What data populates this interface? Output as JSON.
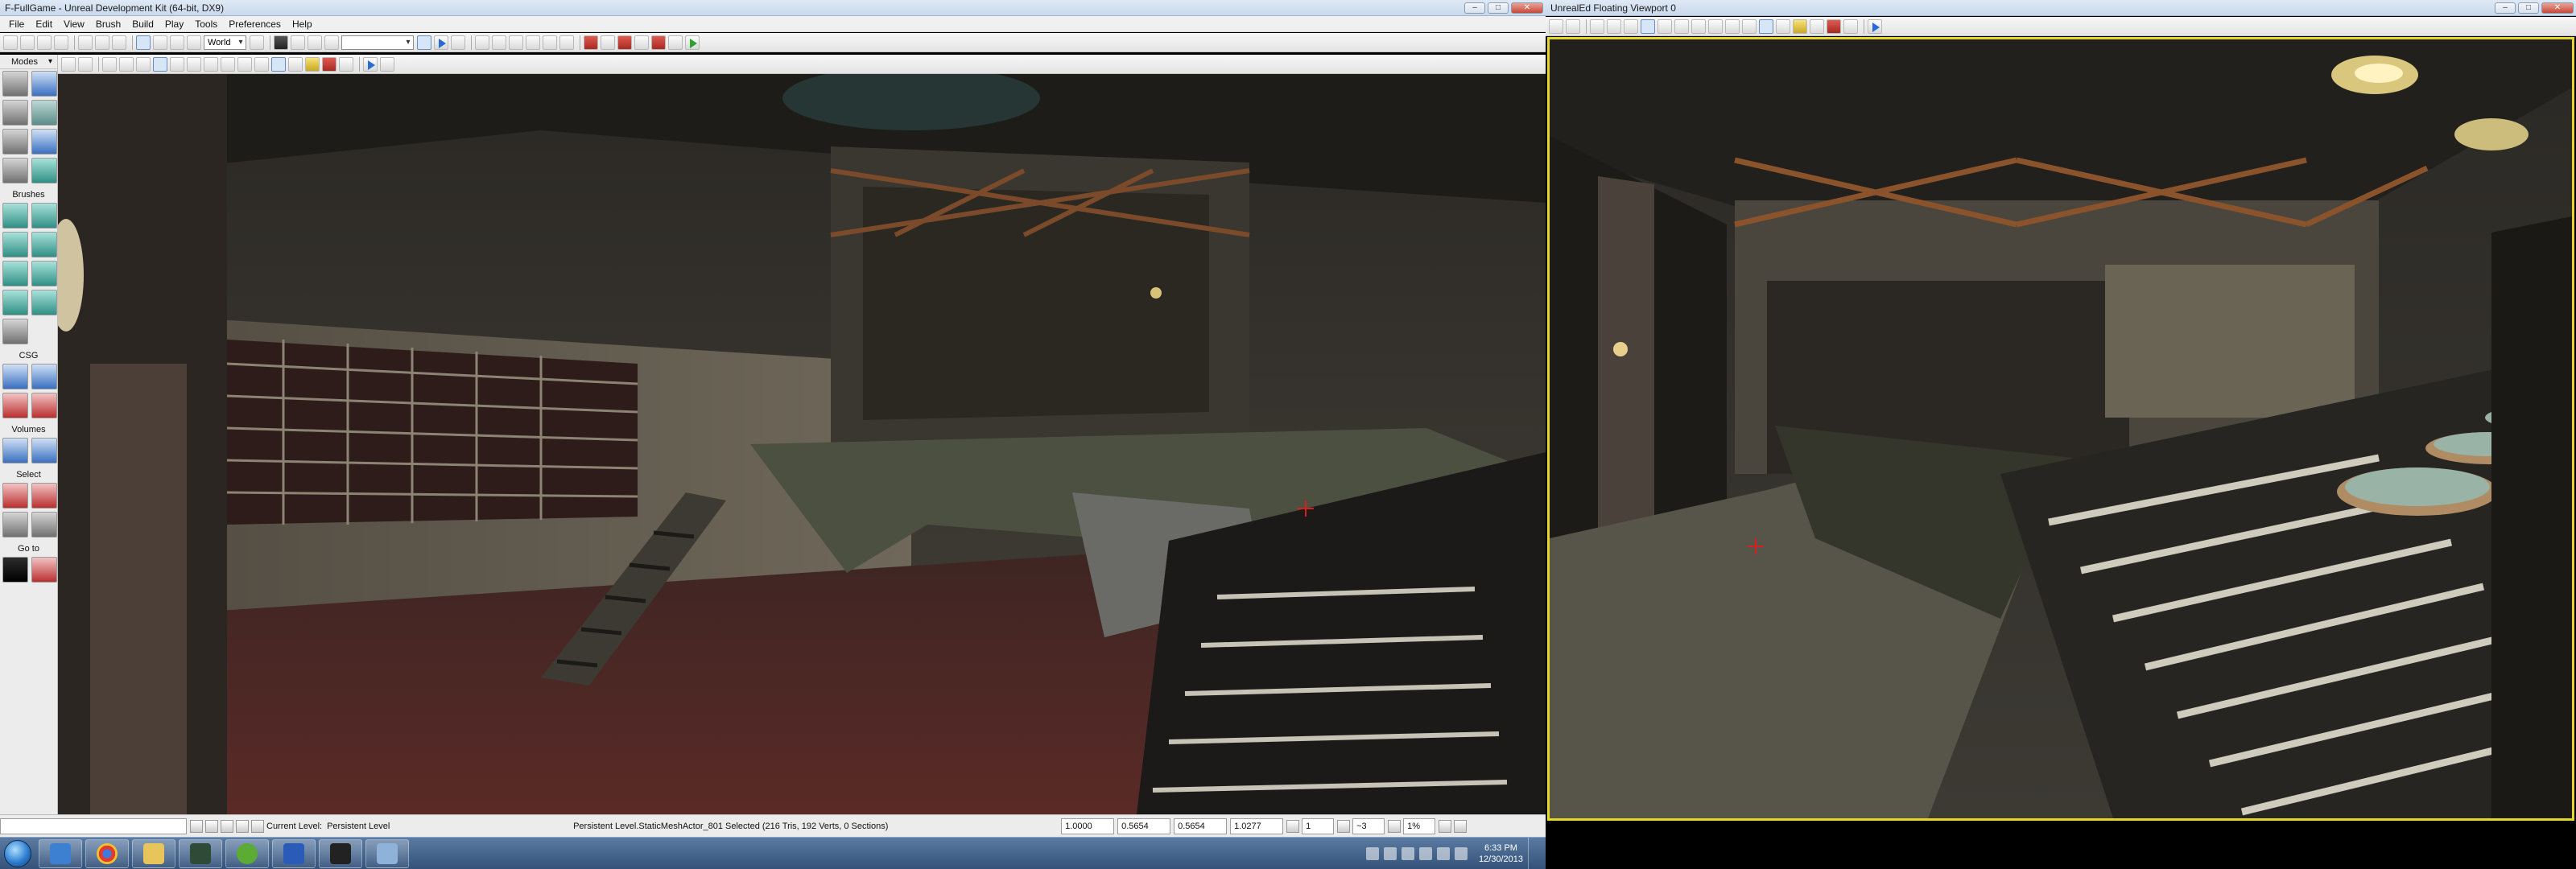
{
  "main_window": {
    "title": "F-FullGame - Unreal Development Kit (64-bit, DX9)",
    "menu": [
      "File",
      "Edit",
      "View",
      "Brush",
      "Build",
      "Play",
      "Tools",
      "Preferences",
      "Help"
    ],
    "toolbar": {
      "coordinate_system": "World"
    },
    "modes_panel": {
      "header": "Modes",
      "groups": [
        "Brushes",
        "CSG",
        "Volumes",
        "Select",
        "Go to"
      ]
    },
    "status_bar": {
      "current_level_label": "Current Level:",
      "current_level_value": "Persistent Level",
      "selection_info": "Persistent Level.StaticMeshActor_801 Selected (216 Tris, 192 Verts, 0 Sections)",
      "field1": "1.0000",
      "field2": "0.5654",
      "field3": "0.5654",
      "field4": "1.0277",
      "grid_value": "1",
      "rotation_snap": "~3",
      "scale_snap": "1%"
    }
  },
  "floating_viewport": {
    "title": "UnrealEd Floating Viewport 0"
  },
  "taskbar": {
    "apps": [
      "windows-explorer",
      "chrome",
      "folder",
      "terminal",
      "utorrent",
      "word",
      "udk",
      "editor"
    ],
    "clock_time": "6:33 PM",
    "clock_date": "12/30/2013"
  },
  "colors": {
    "selection_border": "#e6d52a",
    "start_orb": "#2c7ed0"
  }
}
